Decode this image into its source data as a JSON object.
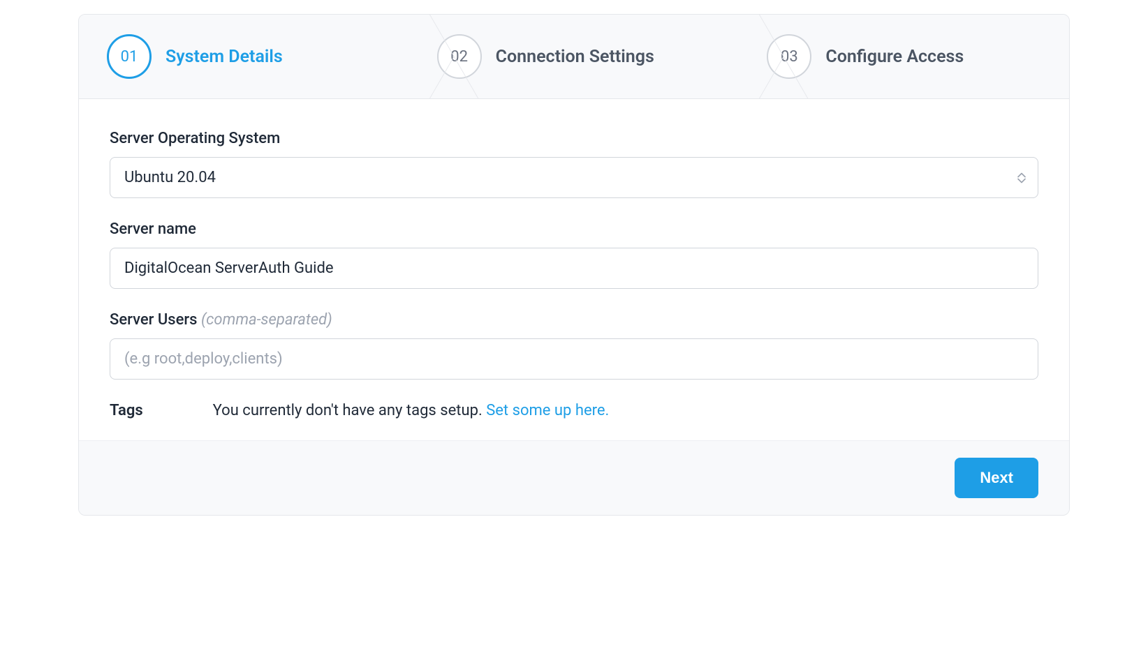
{
  "stepper": {
    "steps": [
      {
        "number": "01",
        "title": "System Details",
        "active": true
      },
      {
        "number": "02",
        "title": "Connection Settings",
        "active": false
      },
      {
        "number": "03",
        "title": "Configure Access",
        "active": false
      }
    ]
  },
  "form": {
    "os": {
      "label": "Server Operating System",
      "value": "Ubuntu 20.04"
    },
    "server_name": {
      "label": "Server name",
      "value": "DigitalOcean ServerAuth Guide"
    },
    "server_users": {
      "label": "Server Users ",
      "hint": "(comma-separated)",
      "placeholder": "(e.g root,deploy,clients)",
      "value": ""
    },
    "tags": {
      "label": "Tags",
      "text": "You currently don't have any tags setup. ",
      "link": "Set some up here."
    }
  },
  "footer": {
    "next_label": "Next"
  }
}
